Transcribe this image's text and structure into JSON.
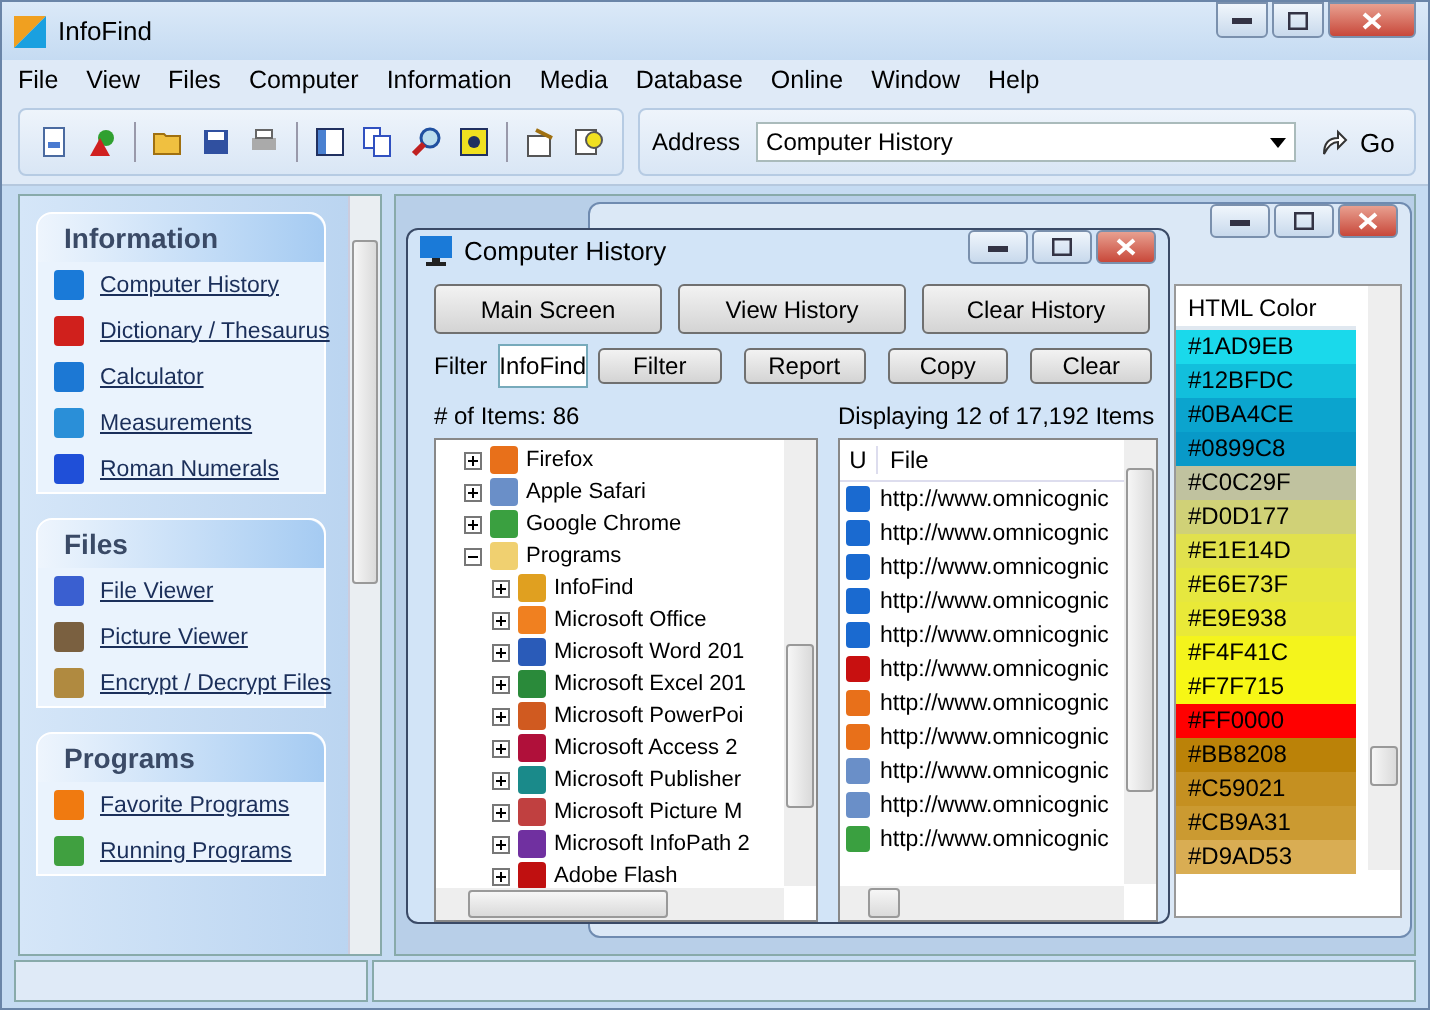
{
  "window": {
    "title": "InfoFind"
  },
  "menu": [
    "File",
    "View",
    "Files",
    "Computer",
    "Information",
    "Media",
    "Database",
    "Online",
    "Window",
    "Help"
  ],
  "toolbar": {
    "address_label": "Address",
    "address_value": "Computer History",
    "go": "Go"
  },
  "sidebar": [
    {
      "title": "Information",
      "items": [
        {
          "label": "Computer History",
          "color": "#1a7ad8"
        },
        {
          "label": "Dictionary / Thesaurus",
          "color": "#d0201c"
        },
        {
          "label": "Calculator",
          "color": "#1c78d4"
        },
        {
          "label": "Measurements",
          "color": "#2a8fd8"
        },
        {
          "label": "Roman Numerals",
          "color": "#1f4fd8"
        }
      ]
    },
    {
      "title": "Files",
      "items": [
        {
          "label": "File Viewer",
          "color": "#3a5fd0"
        },
        {
          "label": "Picture Viewer",
          "color": "#7a6040"
        },
        {
          "label": "Encrypt / Decrypt Files",
          "color": "#b08a40"
        }
      ]
    },
    {
      "title": "Programs",
      "items": [
        {
          "label": "Favorite Programs",
          "color": "#f07a10"
        },
        {
          "label": "Running Programs",
          "color": "#40a040"
        }
      ]
    }
  ],
  "color_window": {
    "column": "HTML Color",
    "rows": [
      {
        "text": "#1AD9EB",
        "color": "#1ad9eb"
      },
      {
        "text": "#12BFDC",
        "color": "#12bfdc"
      },
      {
        "text": "#0BA4CE",
        "color": "#0ba4ce"
      },
      {
        "text": "#0899C8",
        "color": "#0899c8"
      },
      {
        "text": "#C0C29F",
        "color": "#c0c29f"
      },
      {
        "text": "#D0D177",
        "color": "#d0d177"
      },
      {
        "text": "#E1E14D",
        "color": "#e1e14d"
      },
      {
        "text": "#E6E73F",
        "color": "#e6e73f"
      },
      {
        "text": "#E9E938",
        "color": "#e9e938"
      },
      {
        "text": "#F4F41C",
        "color": "#f4f41c"
      },
      {
        "text": "#F7F715",
        "color": "#f7f715"
      },
      {
        "text": "#FF0000",
        "color": "#ff0000"
      },
      {
        "text": "#BB8208",
        "color": "#bb8208"
      },
      {
        "text": "#C59021",
        "color": "#c59021"
      },
      {
        "text": "#CB9A31",
        "color": "#cb9a31"
      },
      {
        "text": "#D9AD53",
        "color": "#d9ad53"
      }
    ]
  },
  "history_window": {
    "title": "Computer History",
    "buttons": [
      "Main Screen",
      "View History",
      "Clear History"
    ],
    "filter_label": "Filter",
    "filter_value": "InfoFind",
    "filter_buttons": [
      "Filter",
      "Report",
      "Copy",
      "Clear"
    ],
    "item_count": "# of Items: 86",
    "displaying": "Displaying 12 of 17,192 Items",
    "tree": [
      {
        "children": [
          {
            "label": "Firefox",
            "expanded": false,
            "color": "#e8701a"
          },
          {
            "label": "Apple Safari",
            "expanded": false,
            "color": "#6a8fc8"
          },
          {
            "label": "Google Chrome",
            "expanded": false,
            "color": "#3aa040"
          }
        ]
      },
      {
        "label": "Programs",
        "expanded": true,
        "color": "#f0d070",
        "children": [
          {
            "label": "InfoFind",
            "expanded": false,
            "color": "#e0a020"
          },
          {
            "label": "Microsoft Office",
            "expanded": false,
            "color": "#f08020"
          },
          {
            "label": "Microsoft Word 201",
            "expanded": false,
            "color": "#2a5bb8"
          },
          {
            "label": "Microsoft Excel 201",
            "expanded": false,
            "color": "#2a8a3a"
          },
          {
            "label": "Microsoft PowerPoi",
            "expanded": false,
            "color": "#d05a20"
          },
          {
            "label": "Microsoft Access 2",
            "expanded": false,
            "color": "#b0103a"
          },
          {
            "label": "Microsoft Publisher",
            "expanded": false,
            "color": "#1a8a8a"
          },
          {
            "label": "Microsoft Picture M",
            "expanded": false,
            "color": "#c04040"
          },
          {
            "label": "Microsoft InfoPath 2",
            "expanded": false,
            "color": "#7030a0"
          },
          {
            "label": "Adobe Flash",
            "expanded": false,
            "color": "#c01010"
          }
        ]
      }
    ],
    "columns": [
      "U",
      "File"
    ],
    "rows": [
      {
        "text": "http://www.omnicognic",
        "color": "#1a6ad0"
      },
      {
        "text": "http://www.omnicognic",
        "color": "#1a6ad0"
      },
      {
        "text": "http://www.omnicognic",
        "color": "#1a6ad0"
      },
      {
        "text": "http://www.omnicognic",
        "color": "#1a6ad0"
      },
      {
        "text": "http://www.omnicognic",
        "color": "#1a6ad0"
      },
      {
        "text": "http://www.omnicognic",
        "color": "#c81010"
      },
      {
        "text": "http://www.omnicognic",
        "color": "#e8701a"
      },
      {
        "text": "http://www.omnicognic",
        "color": "#e8701a"
      },
      {
        "text": "http://www.omnicognic",
        "color": "#6a8fc8"
      },
      {
        "text": "http://www.omnicognic",
        "color": "#6a8fc8"
      },
      {
        "text": "http://www.omnicognic",
        "color": "#3aa040"
      }
    ]
  }
}
